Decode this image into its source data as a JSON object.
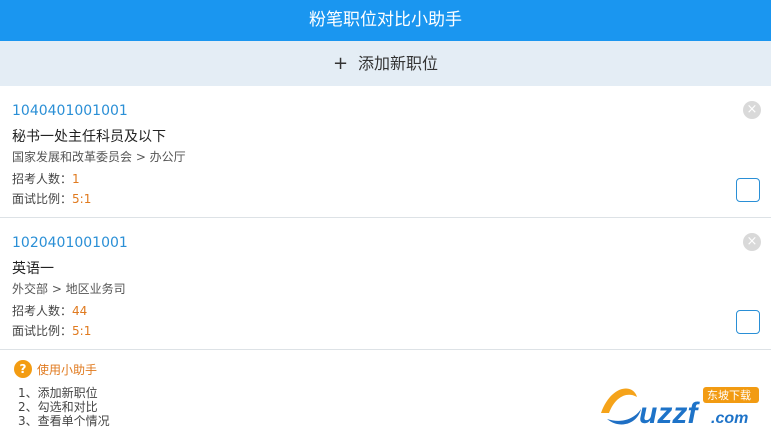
{
  "header": {
    "title": "粉笔职位对比小助手"
  },
  "add_position": {
    "icon": "plus-icon",
    "plus": "+",
    "label": "添加新职位"
  },
  "positions": [
    {
      "code": "1040401001001",
      "name": "秘书一处主任科员及以下",
      "department": "国家发展和改革委员会 > 办公厅",
      "recruit_label": "招考人数：",
      "recruit_value": "1",
      "ratio_label": "面试比例：",
      "ratio_value": "5:1",
      "checked": false
    },
    {
      "code": "1020401001001",
      "name": "英语一",
      "department": "外交部 > 地区业务司",
      "recruit_label": "招考人数：",
      "recruit_value": "44",
      "ratio_label": "面试比例：",
      "ratio_value": "5:1",
      "checked": false
    }
  ],
  "help": {
    "icon": "question-icon",
    "q": "?",
    "title": "使用小助手",
    "steps": [
      "1、添加新职位",
      "2、勾选和对比",
      "3、查看单个情况"
    ]
  },
  "watermark": {
    "brand": "uzzf",
    "suffix": ".com",
    "badge": "东坡下载"
  },
  "colors": {
    "header_bg": "#1a96f0",
    "add_bar_bg": "#e4edf5",
    "code_text": "#2a8fd6",
    "value_text": "#e07a1f",
    "help_icon": "#f39c12"
  }
}
